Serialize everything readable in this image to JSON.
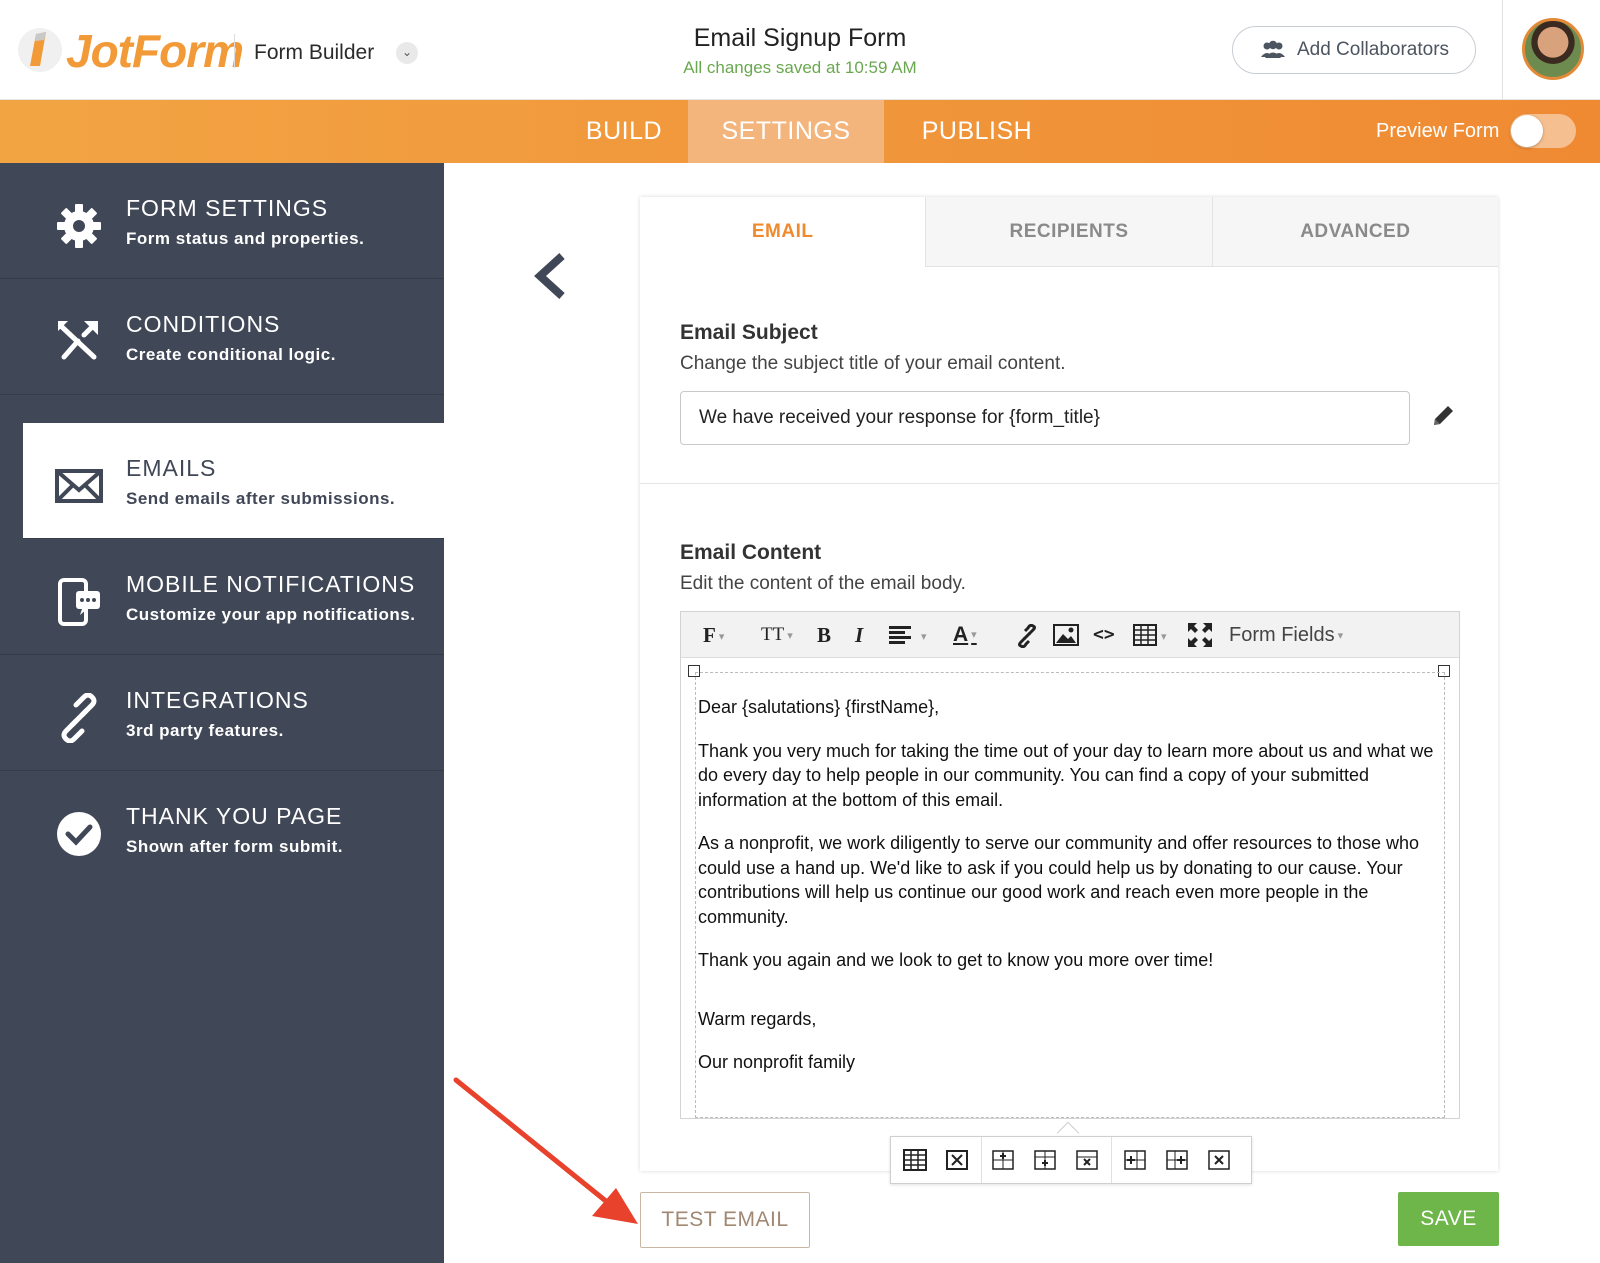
{
  "header": {
    "brand": "JotForm",
    "app_label": "Form Builder",
    "form_title": "Email Signup Form",
    "saved_status": "All changes saved at 10:59 AM",
    "collaborators_label": "Add Collaborators",
    "icons": {
      "logo": "pencil-logo-icon",
      "collab": "users-icon",
      "dropdown": "chevron-down-icon"
    }
  },
  "nav": {
    "tabs": [
      {
        "label": "BUILD",
        "active": false
      },
      {
        "label": "SETTINGS",
        "active": true
      },
      {
        "label": "PUBLISH",
        "active": false
      }
    ],
    "preview_label": "Preview Form",
    "preview_enabled": false
  },
  "sidebar": {
    "items": [
      {
        "title": "FORM SETTINGS",
        "subtitle": "Form status and properties.",
        "icon": "gear-icon",
        "active": false
      },
      {
        "title": "CONDITIONS",
        "subtitle": "Create conditional logic.",
        "icon": "conditions-icon",
        "active": false
      },
      {
        "title": "EMAILS",
        "subtitle": "Send emails after submissions.",
        "icon": "envelope-icon",
        "active": true
      },
      {
        "title": "MOBILE NOTIFICATIONS",
        "subtitle": "Customize your app notifications.",
        "icon": "mobile-chat-icon",
        "active": false
      },
      {
        "title": "INTEGRATIONS",
        "subtitle": "3rd party features.",
        "icon": "link-icon",
        "active": false
      },
      {
        "title": "THANK YOU PAGE",
        "subtitle": "Shown after form submit.",
        "icon": "check-circle-icon",
        "active": false
      }
    ]
  },
  "panel": {
    "subtabs": [
      {
        "label": "EMAIL",
        "active": true
      },
      {
        "label": "RECIPIENTS",
        "active": false
      },
      {
        "label": "ADVANCED",
        "active": false
      }
    ],
    "subject": {
      "title": "Email Subject",
      "description": "Change the subject title of your email content.",
      "value": "We have received your response for {form_title}"
    },
    "content": {
      "title": "Email Content",
      "description": "Edit the content of the email body.",
      "toolbar": {
        "font": "F",
        "font_size": "TT",
        "bold": "B",
        "italic": "I",
        "text_color": "A",
        "form_fields": "Form Fields"
      },
      "body": [
        "Dear {salutations} {firstName},",
        "Thank you very much for taking the time out of your day to learn more about us and what we do every day to help people in our community. You can find a copy of your submitted information at the bottom of this email.",
        "As a nonprofit, we work diligently to serve our community and offer resources to those who could use a hand up. We'd like to ask if you could help us by donating to our cause. Your contributions will help us continue our good work and reach even more people in the community.",
        "Thank you again and we look to get to know you more over time!",
        "Warm regards,",
        "Our nonprofit family"
      ]
    }
  },
  "actions": {
    "test_email": "TEST EMAIL",
    "save": "SAVE"
  },
  "colors": {
    "brand_orange": "#f29a38",
    "sidebar_bg": "#404756",
    "save_green": "#6eb54a",
    "annotation_arrow": "#e8412c"
  }
}
